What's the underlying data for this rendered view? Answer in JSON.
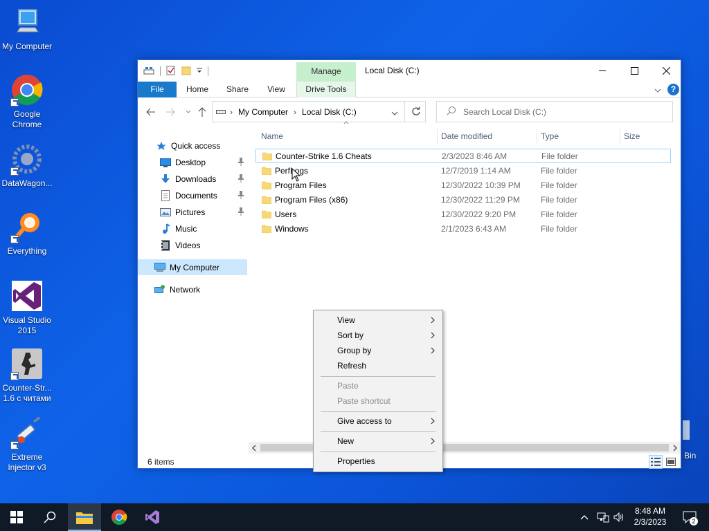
{
  "desktop": {
    "icons": [
      {
        "label": "My Computer"
      },
      {
        "label": "Google Chrome"
      },
      {
        "label": "DataWagon..."
      },
      {
        "label": "Everything"
      },
      {
        "label": "Visual Studio 2015"
      },
      {
        "label": "Counter-Str... 1.6 с читами"
      },
      {
        "label": "Extreme Injector v3"
      }
    ],
    "recycle_bin_partial": "Bin"
  },
  "window": {
    "title": "Local Disk (C:)",
    "manage_tab": "Manage",
    "ribbon_tabs": [
      "File",
      "Home",
      "Share",
      "View",
      "Drive Tools"
    ],
    "breadcrumb": [
      "My Computer",
      "Local Disk (C:)"
    ],
    "search_placeholder": "Search Local Disk (C:)",
    "nav_pane": [
      {
        "label": "Quick access",
        "icon": "star-icon"
      },
      {
        "label": "Desktop",
        "icon": "desktop-icon",
        "pinned": true
      },
      {
        "label": "Downloads",
        "icon": "download-icon",
        "pinned": true
      },
      {
        "label": "Documents",
        "icon": "document-icon",
        "pinned": true
      },
      {
        "label": "Pictures",
        "icon": "pictures-icon",
        "pinned": true
      },
      {
        "label": "Music",
        "icon": "music-icon"
      },
      {
        "label": "Videos",
        "icon": "video-icon"
      },
      {
        "label": "My Computer",
        "icon": "computer-icon",
        "selected": true
      },
      {
        "label": "Network",
        "icon": "network-icon"
      }
    ],
    "columns": [
      "Name",
      "Date modified",
      "Type",
      "Size"
    ],
    "files": [
      {
        "name": "Counter-Strike 1.6 Cheats",
        "date": "2/3/2023 8:46 AM",
        "type": "File folder"
      },
      {
        "name": "PerfLogs",
        "date": "12/7/2019 1:14 AM",
        "type": "File folder"
      },
      {
        "name": "Program Files",
        "date": "12/30/2022 10:39 PM",
        "type": "File folder"
      },
      {
        "name": "Program Files (x86)",
        "date": "12/30/2022 11:29 PM",
        "type": "File folder"
      },
      {
        "name": "Users",
        "date": "12/30/2022 9:20 PM",
        "type": "File folder"
      },
      {
        "name": "Windows",
        "date": "2/1/2023 6:43 AM",
        "type": "File folder"
      }
    ],
    "status": "6 items"
  },
  "context_menu": {
    "items": [
      {
        "label": "View",
        "submenu": true
      },
      {
        "label": "Sort by",
        "submenu": true
      },
      {
        "label": "Group by",
        "submenu": true
      },
      {
        "label": "Refresh"
      },
      {
        "label": "Paste",
        "disabled": true
      },
      {
        "label": "Paste shortcut",
        "disabled": true
      },
      {
        "label": "Give access to",
        "submenu": true
      },
      {
        "label": "New",
        "submenu": true
      },
      {
        "label": "Properties"
      }
    ]
  },
  "taskbar": {
    "time": "8:48 AM",
    "date": "2/3/2023",
    "notification_count": "2"
  },
  "colors": {
    "desktop_bg": "#0f63e8",
    "file_tab": "#1979ca",
    "manage_tab": "#c6efce",
    "selection": "#cce8ff",
    "folder": "#f8d775",
    "taskbar": "#101a26"
  }
}
